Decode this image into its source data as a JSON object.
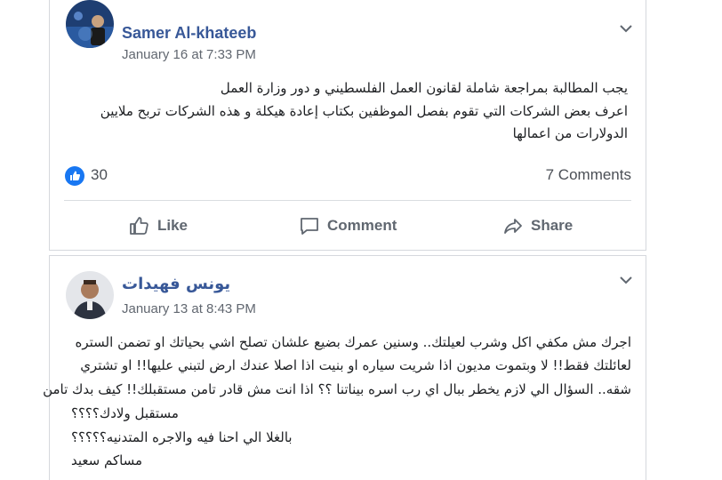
{
  "post1": {
    "author": "Samer Al-khateeb",
    "timestamp": "January 16 at 7:33 PM",
    "text_lines": [
      "يجب المطالبة بمراجعة شاملة لقانون العمل الفلسطيني و دور وزارة العمل",
      "اعرف بعض الشركات التي تقوم بفصل الموظفين بكتاب إعادة هيكلة و هذه الشركات تربح ملايين",
      "الدولارات من اعمالها"
    ],
    "reactions_count": "30",
    "comments_count": "7 Comments",
    "actions": {
      "like": "Like",
      "comment": "Comment",
      "share": "Share"
    }
  },
  "post2": {
    "author": "يونس فهيدات",
    "timestamp": "January 13 at 8:43 PM",
    "text_lines": [
      "اجرك مش مكفي اكل وشرب لعيلتك.. وسنين عمرك بضيع علشان تصلح اشي بحياتك او تضمن الستره",
      "لعائلتك فقط!! لا وبتموت مديون اذا شريت سياره او بنيت اذا اصلا عندك ارض لتبني عليها!! او تشتري",
      "شقه.. السؤال الي لازم يخطر ببال اي رب اسره بيناتنا ؟؟ اذا انت مش قادر تامن مستقبلك!! كيف بدك تامن",
      "مستقبل ولادك؟؟؟؟",
      "بالغلا الي احنا فيه والاجره المتدنيه؟؟؟؟؟",
      "مساكم سعيد"
    ]
  },
  "colors": {
    "author": "#385898",
    "like_blue": "#1877f2",
    "meta": "#616770",
    "action": "#606770"
  },
  "icons": {
    "chevron": "chevron-down-icon",
    "like": "thumbs-up-icon",
    "comment": "comment-bubble-icon",
    "share": "share-arrow-icon"
  }
}
